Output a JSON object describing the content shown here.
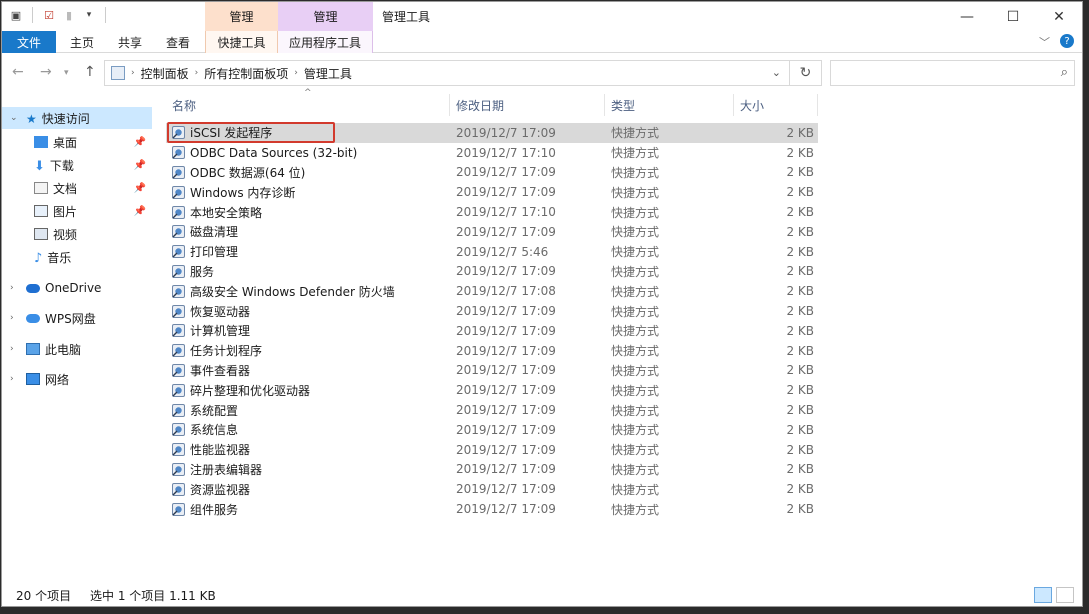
{
  "window": {
    "title": "管理工具",
    "context_tab_1": "管理",
    "context_tab_2": "管理"
  },
  "ribbon": {
    "tabs": [
      "文件",
      "主页",
      "共享",
      "查看",
      "快捷工具",
      "应用程序工具"
    ]
  },
  "address": {
    "crumbs": [
      "控制面板",
      "所有控制面板项",
      "管理工具"
    ]
  },
  "sidebar": {
    "quick_access": "快速访问",
    "quick_items": [
      "桌面",
      "下载",
      "文档",
      "图片",
      "视频",
      "音乐"
    ],
    "top_items": [
      "OneDrive",
      "WPS网盘",
      "此电脑",
      "网络"
    ]
  },
  "columns": {
    "name": "名称",
    "date": "修改日期",
    "type": "类型",
    "size": "大小"
  },
  "files": [
    {
      "name": "iSCSI 发起程序",
      "date": "2019/12/7 17:09",
      "type": "快捷方式",
      "size": "2 KB"
    },
    {
      "name": "ODBC Data Sources (32-bit)",
      "date": "2019/12/7 17:10",
      "type": "快捷方式",
      "size": "2 KB"
    },
    {
      "name": "ODBC 数据源(64 位)",
      "date": "2019/12/7 17:09",
      "type": "快捷方式",
      "size": "2 KB"
    },
    {
      "name": "Windows 内存诊断",
      "date": "2019/12/7 17:09",
      "type": "快捷方式",
      "size": "2 KB"
    },
    {
      "name": "本地安全策略",
      "date": "2019/12/7 17:10",
      "type": "快捷方式",
      "size": "2 KB"
    },
    {
      "name": "磁盘清理",
      "date": "2019/12/7 17:09",
      "type": "快捷方式",
      "size": "2 KB"
    },
    {
      "name": "打印管理",
      "date": "2019/12/7 5:46",
      "type": "快捷方式",
      "size": "2 KB"
    },
    {
      "name": "服务",
      "date": "2019/12/7 17:09",
      "type": "快捷方式",
      "size": "2 KB"
    },
    {
      "name": "高级安全 Windows Defender 防火墙",
      "date": "2019/12/7 17:08",
      "type": "快捷方式",
      "size": "2 KB"
    },
    {
      "name": "恢复驱动器",
      "date": "2019/12/7 17:09",
      "type": "快捷方式",
      "size": "2 KB"
    },
    {
      "name": "计算机管理",
      "date": "2019/12/7 17:09",
      "type": "快捷方式",
      "size": "2 KB"
    },
    {
      "name": "任务计划程序",
      "date": "2019/12/7 17:09",
      "type": "快捷方式",
      "size": "2 KB"
    },
    {
      "name": "事件查看器",
      "date": "2019/12/7 17:09",
      "type": "快捷方式",
      "size": "2 KB"
    },
    {
      "name": "碎片整理和优化驱动器",
      "date": "2019/12/7 17:09",
      "type": "快捷方式",
      "size": "2 KB"
    },
    {
      "name": "系统配置",
      "date": "2019/12/7 17:09",
      "type": "快捷方式",
      "size": "2 KB"
    },
    {
      "name": "系统信息",
      "date": "2019/12/7 17:09",
      "type": "快捷方式",
      "size": "2 KB"
    },
    {
      "name": "性能监视器",
      "date": "2019/12/7 17:09",
      "type": "快捷方式",
      "size": "2 KB"
    },
    {
      "name": "注册表编辑器",
      "date": "2019/12/7 17:09",
      "type": "快捷方式",
      "size": "2 KB"
    },
    {
      "name": "资源监视器",
      "date": "2019/12/7 17:09",
      "type": "快捷方式",
      "size": "2 KB"
    },
    {
      "name": "组件服务",
      "date": "2019/12/7 17:09",
      "type": "快捷方式",
      "size": "2 KB"
    }
  ],
  "selected_index": 0,
  "status": {
    "count": "20 个项目",
    "selection": "选中 1 个项目  1.11 KB"
  },
  "colors": {
    "accent": "#1979ca",
    "selection": "#cce8ff",
    "highlight_box": "#d23a2d",
    "context_tab_tools": "#fde0cc",
    "context_tab_app": "#e8cff5"
  },
  "icons": {
    "file_shortcut": "admin-tool-shortcut-icon",
    "quick_access": "star-icon",
    "onedrive": "cloud-icon",
    "this_pc": "computer-icon",
    "network": "network-icon"
  }
}
